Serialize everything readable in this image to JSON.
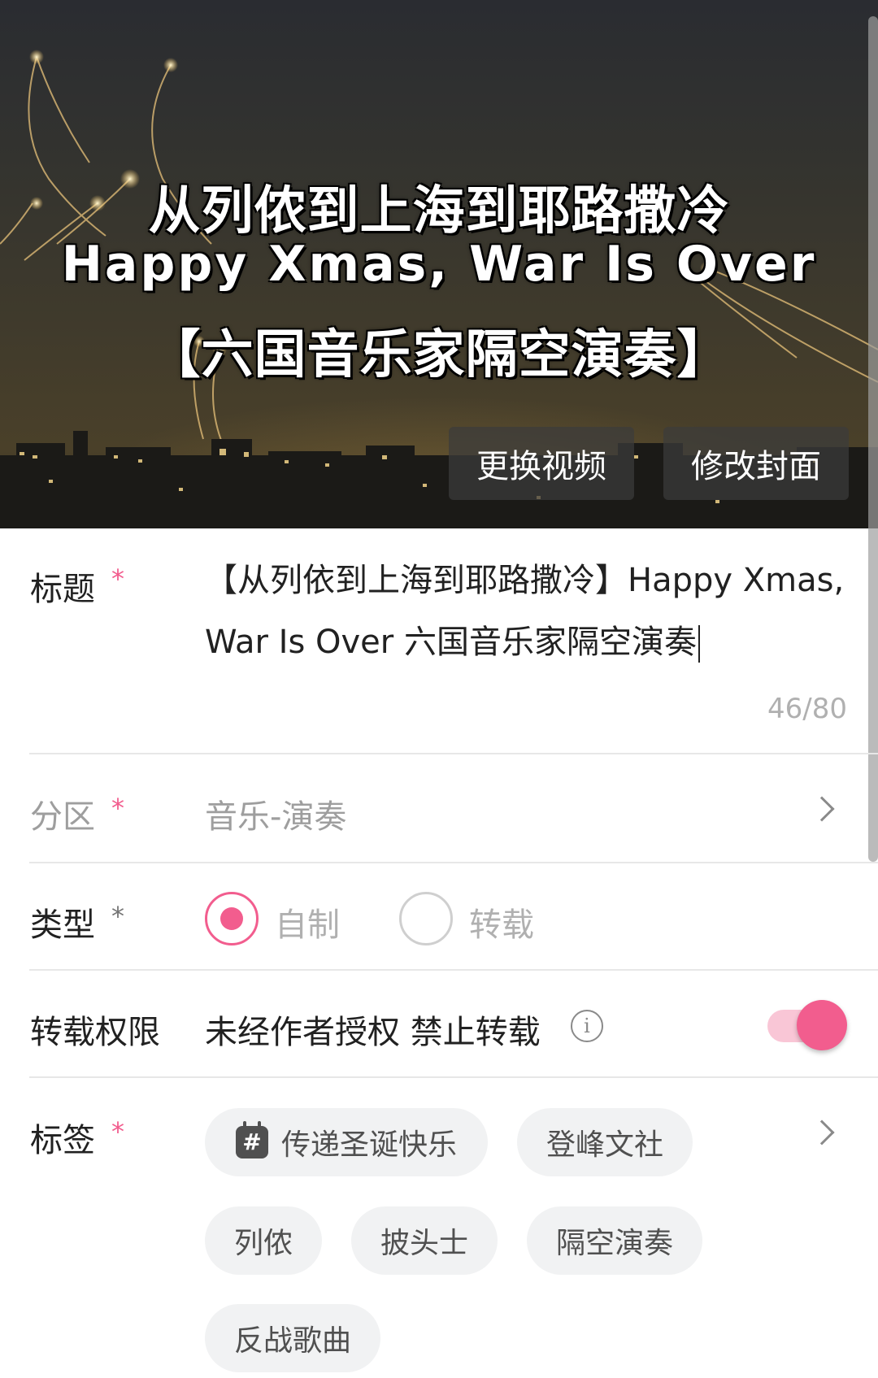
{
  "cover": {
    "line1": "从列侬到上海到耶路撒冷",
    "line2": "Happy Xmas, War Is Over",
    "line3": "【六国音乐家隔空演奏】",
    "change_video_label": "更换视频",
    "edit_cover_label": "修改封面"
  },
  "title_field": {
    "label": "标题",
    "required_mark": "*",
    "value": "【从列依到上海到耶路撒冷】Happy Xmas, War Is Over 六国音乐家隔空演奏",
    "count": "46/80"
  },
  "zone_field": {
    "label": "分区",
    "required_mark": "*",
    "value": "音乐-演奏",
    "chevron_icon": "chevron-right-icon"
  },
  "type_field": {
    "label": "类型",
    "required_mark": "*",
    "options": [
      {
        "label": "自制",
        "selected": true
      },
      {
        "label": "转载",
        "selected": false
      }
    ]
  },
  "permission_field": {
    "label": "转载权限",
    "value": "未经作者授权 禁止转载",
    "info_icon": "info-icon",
    "info_glyph": "i",
    "toggle_on": true
  },
  "tags_field": {
    "label": "标签",
    "required_mark": "*",
    "tags": [
      {
        "label": "传递圣诞快乐",
        "icon": "topic-hash-icon",
        "icon_glyph": "#"
      },
      {
        "label": "登峰文社"
      },
      {
        "label": "列侬"
      },
      {
        "label": "披头士"
      },
      {
        "label": "隔空演奏"
      },
      {
        "label": "反战歌曲"
      }
    ]
  },
  "colors": {
    "accent": "#f25d8e",
    "chip_bg": "#f1f2f3",
    "muted_text": "#9e9e9e"
  }
}
